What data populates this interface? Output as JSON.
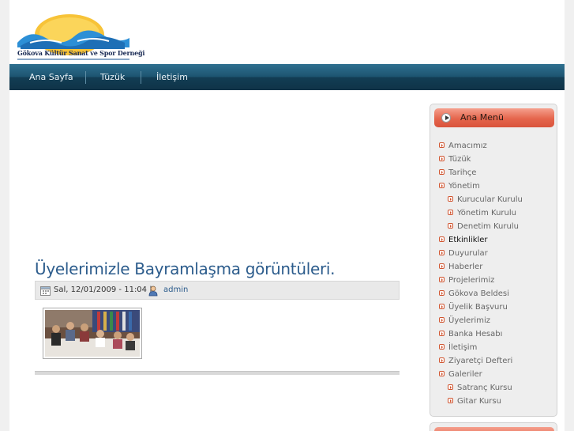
{
  "header": {
    "logo_text": "Gökova Kültür Sanat ve Spor Derneği"
  },
  "nav": {
    "items": [
      {
        "label": "Ana Sayfa"
      },
      {
        "label": "Tüzük"
      },
      {
        "label": "İletişim"
      }
    ]
  },
  "post": {
    "title": "Üyelerimizle Bayramlaşma görüntüleri.",
    "date": "Sal, 12/01/2009 - 11:04 |",
    "author": "admin"
  },
  "sidebar": {
    "title": "Ana Menü",
    "items": [
      {
        "label": "Amacımız",
        "level": 0
      },
      {
        "label": "Tüzük",
        "level": 0
      },
      {
        "label": "Tarihçe",
        "level": 0
      },
      {
        "label": "Yönetim",
        "level": 0
      },
      {
        "label": "Kurucular Kurulu",
        "level": 1
      },
      {
        "label": "Yönetim Kurulu",
        "level": 1
      },
      {
        "label": "Denetim Kurulu",
        "level": 1
      },
      {
        "label": "Etkinlikler",
        "level": 0,
        "active": true
      },
      {
        "label": "Duyurular",
        "level": 0
      },
      {
        "label": "Haberler",
        "level": 0
      },
      {
        "label": "Projelerimiz",
        "level": 0
      },
      {
        "label": "Gökova Beldesi",
        "level": 0
      },
      {
        "label": "Üyelik Başvuru",
        "level": 0
      },
      {
        "label": "Üyelerimiz",
        "level": 0
      },
      {
        "label": "Banka Hesabı",
        "level": 0
      },
      {
        "label": "İletişim",
        "level": 0
      },
      {
        "label": "Ziyaretçi Defteri",
        "level": 0
      },
      {
        "label": "Galeriler",
        "level": 0
      },
      {
        "label": "Satranç Kursu",
        "level": 1
      },
      {
        "label": "Gitar Kursu",
        "level": 1
      }
    ]
  },
  "colors": {
    "nav_bg": "#1d5470",
    "title_blue": "#2c5c8c",
    "menu_accent": "#e5654c",
    "bullet": "#d0542f"
  }
}
